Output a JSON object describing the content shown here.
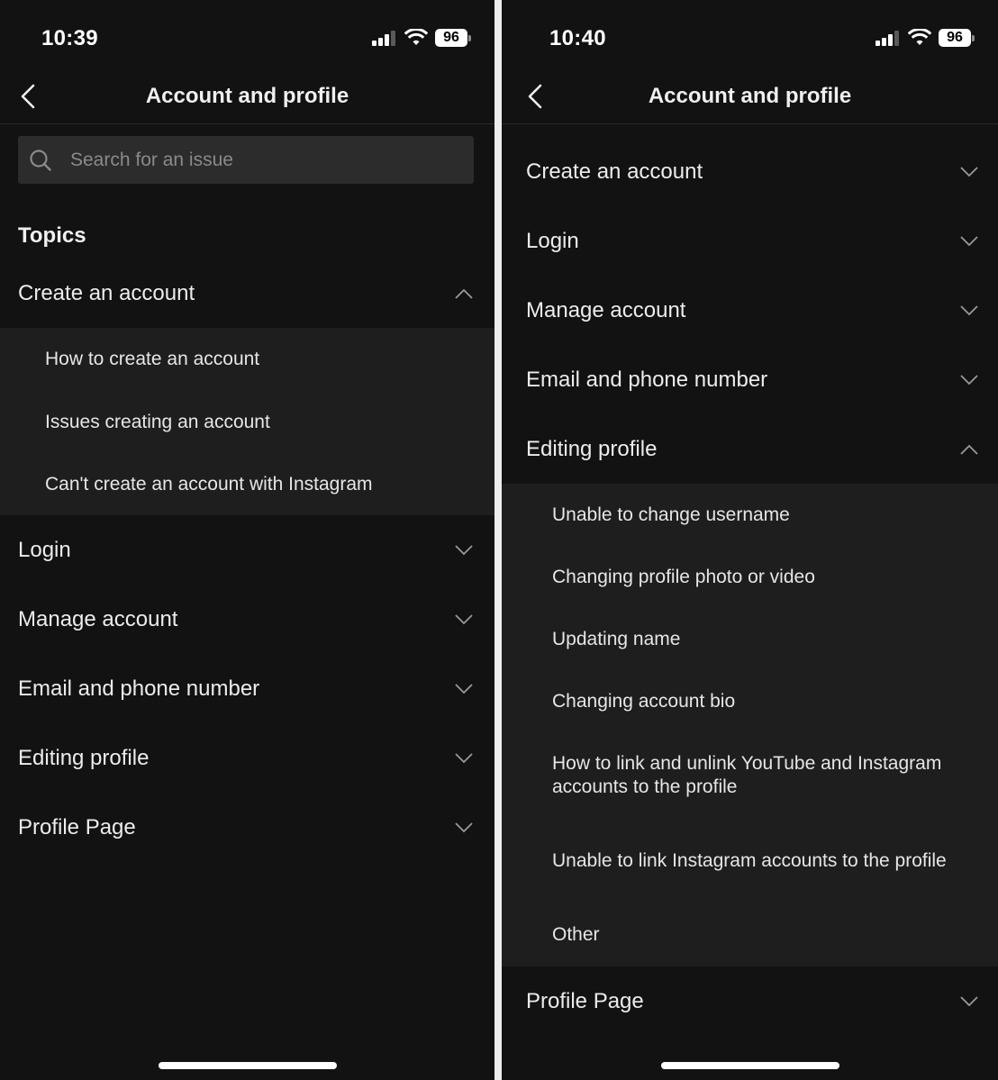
{
  "screens": [
    {
      "status": {
        "time": "10:39",
        "battery": "96"
      },
      "nav": {
        "title": "Account and profile",
        "back_icon": "chevron-left-icon"
      },
      "search": {
        "placeholder": "Search for an issue",
        "value": ""
      },
      "topics_title": "Topics",
      "topics": [
        {
          "label": "Create an account",
          "expanded": true,
          "items": [
            "How to create an account",
            "Issues creating an account",
            "Can't create an account with Instagram"
          ]
        },
        {
          "label": "Login",
          "expanded": false
        },
        {
          "label": "Manage account",
          "expanded": false
        },
        {
          "label": "Email and phone number",
          "expanded": false
        },
        {
          "label": "Editing profile",
          "expanded": false
        },
        {
          "label": "Profile Page",
          "expanded": false
        }
      ]
    },
    {
      "status": {
        "time": "10:40",
        "battery": "96"
      },
      "nav": {
        "title": "Account and profile",
        "back_icon": "chevron-left-icon"
      },
      "topics": [
        {
          "label": "Create an account",
          "expanded": false
        },
        {
          "label": "Login",
          "expanded": false
        },
        {
          "label": "Manage account",
          "expanded": false
        },
        {
          "label": "Email and phone number",
          "expanded": false
        },
        {
          "label": "Editing profile",
          "expanded": true,
          "items": [
            "Unable to change username",
            "Changing profile photo or video",
            "Updating name",
            "Changing account bio",
            "How to link and unlink YouTube and Instagram accounts to the profile",
            "Unable to link Instagram accounts to the profile",
            "Other"
          ]
        },
        {
          "label": "Profile Page",
          "expanded": false
        }
      ]
    }
  ],
  "colors": {
    "background": "#121212",
    "expanded_background": "#1e1e1e",
    "search_background": "#2c2c2c",
    "text": "#ececec"
  }
}
